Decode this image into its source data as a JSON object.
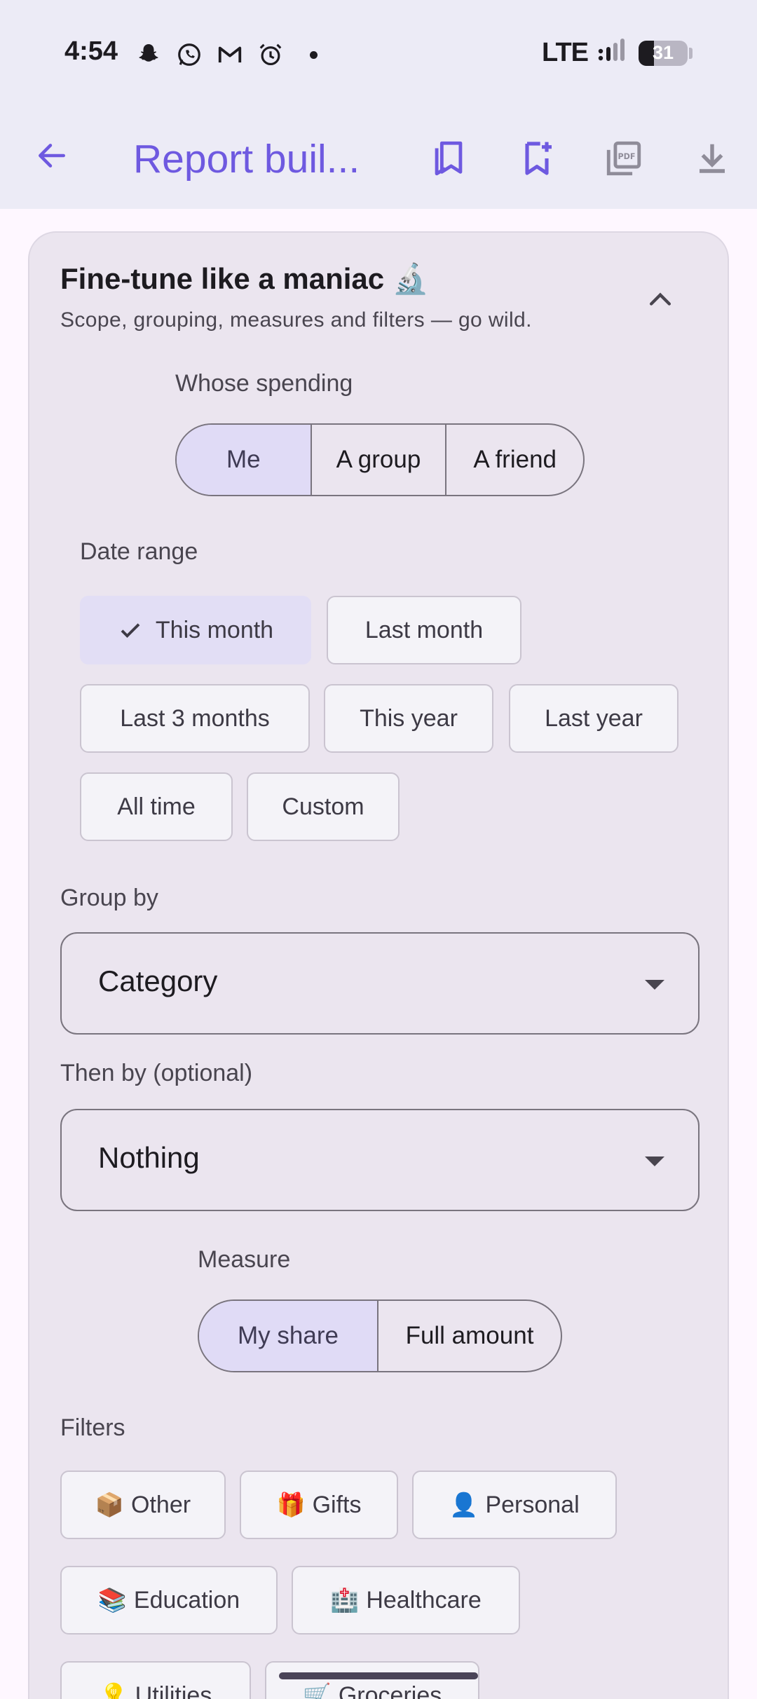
{
  "status": {
    "time": "4:54",
    "network": "LTE",
    "battery": "31",
    "icons": [
      "snapchat-icon",
      "whatsapp-icon",
      "gmail-icon",
      "alarm-icon"
    ]
  },
  "appbar": {
    "title": "Report buil...",
    "actions": [
      "saved-reports-icon",
      "save-report-icon",
      "pdf-icon",
      "download-icon"
    ]
  },
  "card": {
    "title": "Fine-tune like a maniac 🔬",
    "subtitle": "Scope, grouping, measures and filters — go wild.",
    "whose": {
      "label": "Whose spending",
      "options": [
        "Me",
        "A group",
        "A friend"
      ],
      "selected": "Me"
    },
    "date_range": {
      "label": "Date range",
      "options": [
        "This month",
        "Last month",
        "Last 3 months",
        "This year",
        "Last year",
        "All time",
        "Custom"
      ],
      "selected": "This month"
    },
    "group_by": {
      "label": "Group by",
      "value": "Category"
    },
    "then_by": {
      "label": "Then by (optional)",
      "value": "Nothing"
    },
    "measure": {
      "label": "Measure",
      "options": [
        "My share",
        "Full amount"
      ],
      "selected": "My share"
    },
    "filters": {
      "label": "Filters",
      "items": [
        {
          "emoji": "📦",
          "label": "Other"
        },
        {
          "emoji": "🎁",
          "label": "Gifts"
        },
        {
          "emoji": "👤",
          "label": "Personal"
        },
        {
          "emoji": "📚",
          "label": "Education"
        },
        {
          "emoji": "🏥",
          "label": "Healthcare"
        },
        {
          "emoji": "💡",
          "label": "Utilities"
        },
        {
          "emoji": "🛒",
          "label": "Groceries"
        }
      ]
    }
  },
  "colors": {
    "accent": "#6e59e0",
    "selected_bg": "#e0dbf6",
    "card_bg": "#ebe5ef",
    "bar_bg": "#ecebf6"
  }
}
